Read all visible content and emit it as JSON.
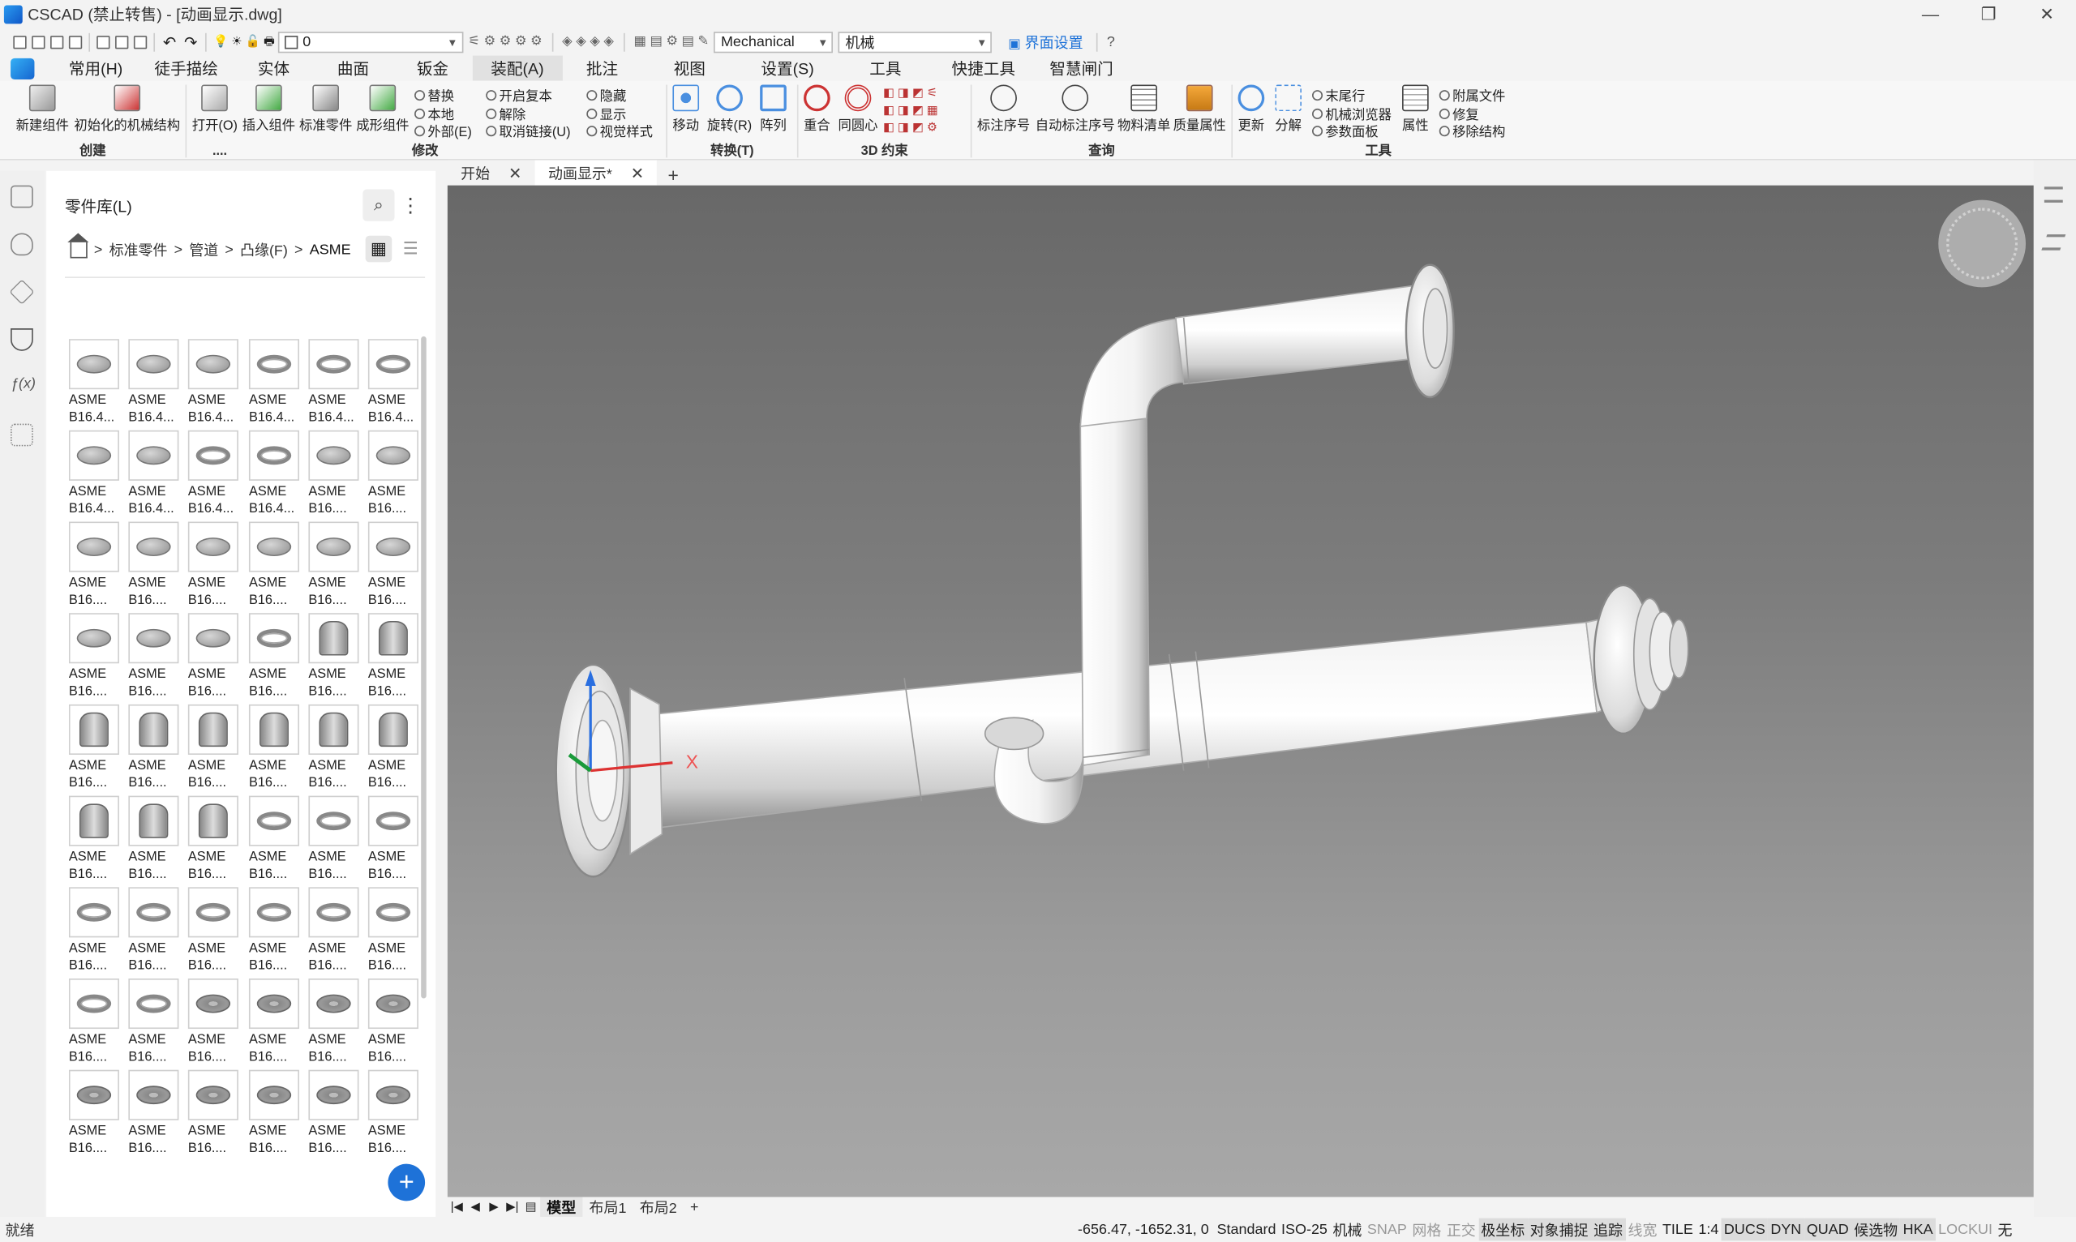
{
  "titlebar": {
    "title": "CSCAD (禁止转售) - [动画显示.dwg]",
    "minimize": "—",
    "restore": "❐",
    "close": "✕"
  },
  "qat": {
    "layer_value": "0",
    "style_value": "Mechanical",
    "scheme_value": "机械",
    "ui_settings": "界面设置"
  },
  "menu": [
    {
      "label": "常用(H)"
    },
    {
      "label": "徒手描绘"
    },
    {
      "label": "实体"
    },
    {
      "label": "曲面"
    },
    {
      "label": "钣金"
    },
    {
      "label": "装配(A)"
    },
    {
      "label": "批注"
    },
    {
      "label": "视图"
    },
    {
      "label": "设置(S)"
    },
    {
      "label": "工具"
    },
    {
      "label": "快捷工具"
    },
    {
      "label": "智慧闸门"
    }
  ],
  "ribbon": {
    "groups": {
      "create": "创建",
      "modify": "修改",
      "dots": "....",
      "transform": "转换(T)",
      "constraint3d": "3D 约束",
      "query": "查询",
      "tools": "工具"
    },
    "buttons": {
      "new_component": "新建组件",
      "init_mech": "初始化的机械结构",
      "open": "打开(O)",
      "insert_component": "插入组件",
      "std_part": "标准零件",
      "form_component": "成形组件",
      "replace": "替换",
      "local": "本地",
      "external": "外部(E)",
      "open_copy": "开启复本",
      "release": "解除",
      "unlink": "取消链接(U)",
      "hide": "隐藏",
      "show": "显示",
      "visual_style": "视觉样式",
      "move": "移动",
      "rotate": "旋转(R)",
      "array": "阵列",
      "coincident": "重合",
      "concentric": "同圆心",
      "balloon": "标注序号",
      "auto_balloon": "自动标注序号",
      "bom": "物料清单",
      "mass_props": "质量属性",
      "update": "更新",
      "explode": "分解",
      "end_row": "末尾行",
      "mech_browser": "机械浏览器",
      "param_panel": "参数面板",
      "properties": "属性",
      "attach_file": "附属文件",
      "repair": "修复",
      "remove_structure": "移除结构"
    }
  },
  "library": {
    "title": "零件库(L)",
    "search_icon": "⌕",
    "more_icon": "⋮",
    "breadcrumb": [
      "标准零件",
      "管道",
      "凸缘(F)",
      "ASME"
    ],
    "parts": [
      {
        "l1": "ASME",
        "l2": "B16.4...",
        "t": "disc"
      },
      {
        "l1": "ASME",
        "l2": "B16.4...",
        "t": "disc"
      },
      {
        "l1": "ASME",
        "l2": "B16.4...",
        "t": "disc"
      },
      {
        "l1": "ASME",
        "l2": "B16.4...",
        "t": "ring"
      },
      {
        "l1": "ASME",
        "l2": "B16.4...",
        "t": "ring"
      },
      {
        "l1": "ASME",
        "l2": "B16.4...",
        "t": "ring"
      },
      {
        "l1": "ASME",
        "l2": "B16.4...",
        "t": "disc"
      },
      {
        "l1": "ASME",
        "l2": "B16.4...",
        "t": "disc"
      },
      {
        "l1": "ASME",
        "l2": "B16.4...",
        "t": "ring"
      },
      {
        "l1": "ASME",
        "l2": "B16.4...",
        "t": "ring"
      },
      {
        "l1": "ASME",
        "l2": "B16....",
        "t": "disc"
      },
      {
        "l1": "ASME",
        "l2": "B16....",
        "t": "disc"
      },
      {
        "l1": "ASME",
        "l2": "B16....",
        "t": "disc"
      },
      {
        "l1": "ASME",
        "l2": "B16....",
        "t": "disc"
      },
      {
        "l1": "ASME",
        "l2": "B16....",
        "t": "disc"
      },
      {
        "l1": "ASME",
        "l2": "B16....",
        "t": "disc"
      },
      {
        "l1": "ASME",
        "l2": "B16....",
        "t": "disc"
      },
      {
        "l1": "ASME",
        "l2": "B16....",
        "t": "disc"
      },
      {
        "l1": "ASME",
        "l2": "B16....",
        "t": "disc"
      },
      {
        "l1": "ASME",
        "l2": "B16....",
        "t": "disc"
      },
      {
        "l1": "ASME",
        "l2": "B16....",
        "t": "disc"
      },
      {
        "l1": "ASME",
        "l2": "B16....",
        "t": "ring"
      },
      {
        "l1": "ASME",
        "l2": "B16....",
        "t": "hub"
      },
      {
        "l1": "ASME",
        "l2": "B16....",
        "t": "hub"
      },
      {
        "l1": "ASME",
        "l2": "B16....",
        "t": "hub"
      },
      {
        "l1": "ASME",
        "l2": "B16....",
        "t": "hub"
      },
      {
        "l1": "ASME",
        "l2": "B16....",
        "t": "hub"
      },
      {
        "l1": "ASME",
        "l2": "B16....",
        "t": "hub"
      },
      {
        "l1": "ASME",
        "l2": "B16....",
        "t": "hub"
      },
      {
        "l1": "ASME",
        "l2": "B16....",
        "t": "hub"
      },
      {
        "l1": "ASME",
        "l2": "B16....",
        "t": "hub"
      },
      {
        "l1": "ASME",
        "l2": "B16....",
        "t": "hub"
      },
      {
        "l1": "ASME",
        "l2": "B16....",
        "t": "hub"
      },
      {
        "l1": "ASME",
        "l2": "B16....",
        "t": "ring"
      },
      {
        "l1": "ASME",
        "l2": "B16....",
        "t": "ring"
      },
      {
        "l1": "ASME",
        "l2": "B16....",
        "t": "ring"
      },
      {
        "l1": "ASME",
        "l2": "B16....",
        "t": "ring"
      },
      {
        "l1": "ASME",
        "l2": "B16....",
        "t": "ring"
      },
      {
        "l1": "ASME",
        "l2": "B16....",
        "t": "ring"
      },
      {
        "l1": "ASME",
        "l2": "B16....",
        "t": "ring"
      },
      {
        "l1": "ASME",
        "l2": "B16....",
        "t": "ring"
      },
      {
        "l1": "ASME",
        "l2": "B16....",
        "t": "ring"
      },
      {
        "l1": "ASME",
        "l2": "B16....",
        "t": "ring"
      },
      {
        "l1": "ASME",
        "l2": "B16....",
        "t": "ring"
      },
      {
        "l1": "ASME",
        "l2": "B16....",
        "t": "plate"
      },
      {
        "l1": "ASME",
        "l2": "B16....",
        "t": "plate"
      },
      {
        "l1": "ASME",
        "l2": "B16....",
        "t": "plate"
      },
      {
        "l1": "ASME",
        "l2": "B16....",
        "t": "plate"
      },
      {
        "l1": "ASME",
        "l2": "B16....",
        "t": "plate"
      },
      {
        "l1": "ASME",
        "l2": "B16....",
        "t": "plate"
      },
      {
        "l1": "ASME",
        "l2": "B16....",
        "t": "plate"
      },
      {
        "l1": "ASME",
        "l2": "B16....",
        "t": "plate"
      },
      {
        "l1": "ASME",
        "l2": "B16....",
        "t": "plate"
      },
      {
        "l1": "ASME",
        "l2": "B16....",
        "t": "plate"
      }
    ],
    "add_button": "+"
  },
  "doctabs": {
    "start": "开始",
    "current": "动画显示*",
    "new": "+"
  },
  "viewport": {
    "axis_label": "X"
  },
  "layouts": {
    "model": "模型",
    "layout1": "布局1",
    "layout2": "布局2",
    "add": "+"
  },
  "status": {
    "ready": "就绪",
    "coords": "-656.47, -1652.31, 0",
    "toggles": [
      {
        "label": "Standard",
        "state": "on"
      },
      {
        "label": "ISO-25",
        "state": "on"
      },
      {
        "label": "机械",
        "state": "on"
      },
      {
        "label": "SNAP",
        "state": "off"
      },
      {
        "label": "网格",
        "state": "off"
      },
      {
        "label": "正交",
        "state": "off"
      },
      {
        "label": "极坐标",
        "state": "hl"
      },
      {
        "label": "对象捕捉",
        "state": "hl"
      },
      {
        "label": "追踪",
        "state": "hl"
      },
      {
        "label": "线宽",
        "state": "off"
      },
      {
        "label": "TILE",
        "state": "on"
      },
      {
        "label": "1:4",
        "state": "on"
      },
      {
        "label": "DUCS",
        "state": "hl"
      },
      {
        "label": "DYN",
        "state": "hl"
      },
      {
        "label": "QUAD",
        "state": "hl"
      },
      {
        "label": "候选物",
        "state": "hl"
      },
      {
        "label": "HKA",
        "state": "hl"
      },
      {
        "label": "LOCKUI",
        "state": "off"
      },
      {
        "label": "无",
        "state": "on"
      }
    ]
  }
}
